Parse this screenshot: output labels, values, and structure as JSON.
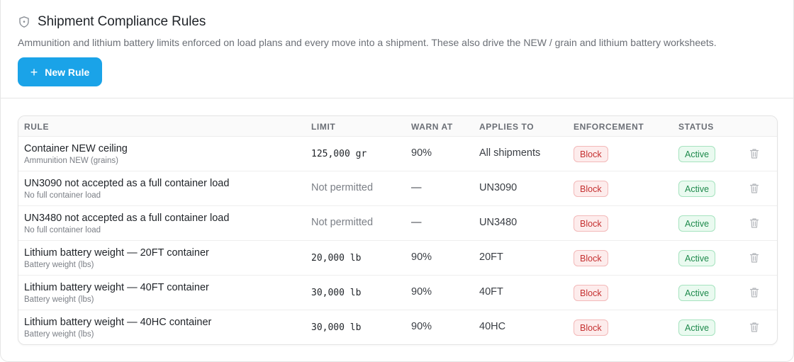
{
  "header": {
    "icon": "shield-icon",
    "title": "Shipment Compliance Rules",
    "subtitle": "Ammunition and lithium battery limits enforced on load plans and every move into a shipment. These also drive the NEW / grain and lithium battery worksheets."
  },
  "toolbar": {
    "new_rule_label": "New Rule"
  },
  "table": {
    "columns": {
      "rule": "RULE",
      "limit": "LIMIT",
      "warn_at": "WARN AT",
      "applies_to": "APPLIES TO",
      "enforcement": "ENFORCEMENT",
      "status": "STATUS"
    },
    "rows": [
      {
        "name": "Container NEW ceiling",
        "subtitle": "Ammunition NEW (grains)",
        "limit": "125,000 gr",
        "warn_at": "90%",
        "applies_to": "All shipments",
        "enforcement": "Block",
        "status": "Active"
      },
      {
        "name": "UN3090 not accepted as a full container load",
        "subtitle": "No full container load",
        "limit": "Not permitted",
        "warn_at": "—",
        "applies_to": "UN3090",
        "enforcement": "Block",
        "status": "Active"
      },
      {
        "name": "UN3480 not accepted as a full container load",
        "subtitle": "No full container load",
        "limit": "Not permitted",
        "warn_at": "—",
        "applies_to": "UN3480",
        "enforcement": "Block",
        "status": "Active"
      },
      {
        "name": "Lithium battery weight — 20FT container",
        "subtitle": "Battery weight (lbs)",
        "limit": "20,000 lb",
        "warn_at": "90%",
        "applies_to": "20FT",
        "enforcement": "Block",
        "status": "Active"
      },
      {
        "name": "Lithium battery weight — 40FT container",
        "subtitle": "Battery weight (lbs)",
        "limit": "30,000 lb",
        "warn_at": "90%",
        "applies_to": "40FT",
        "enforcement": "Block",
        "status": "Active"
      },
      {
        "name": "Lithium battery weight — 40HC container",
        "subtitle": "Battery weight (lbs)",
        "limit": "30,000 lb",
        "warn_at": "90%",
        "applies_to": "40HC",
        "enforcement": "Block",
        "status": "Active"
      }
    ]
  },
  "colors": {
    "accent": "#1aa3e8",
    "block_text": "#c53030",
    "active_text": "#1f8a4c"
  }
}
